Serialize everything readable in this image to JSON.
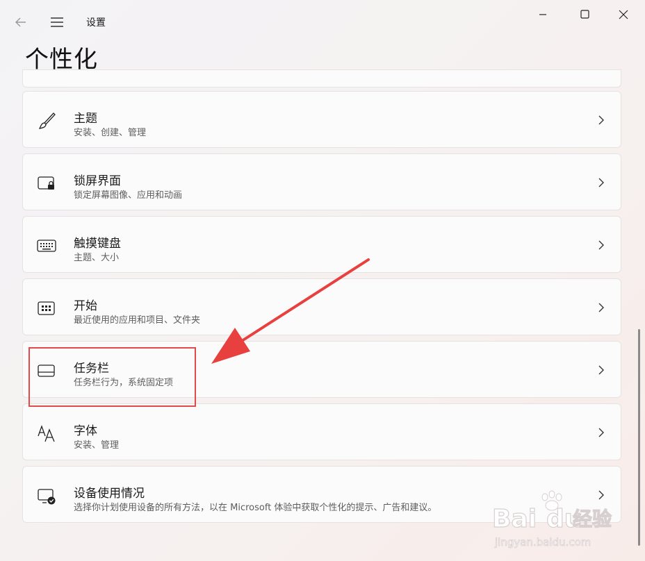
{
  "window": {
    "app_title": "设置",
    "page_title": "个性化"
  },
  "icons": {
    "back": "back-arrow-icon",
    "menu": "hamburger-menu-icon",
    "minimize": "minimize-icon",
    "maximize": "maximize-icon",
    "close": "close-icon"
  },
  "items": [
    {
      "title": "主题",
      "subtitle": "安装、创建、管理",
      "icon": "brush-icon"
    },
    {
      "title": "锁屏界面",
      "subtitle": "锁定屏幕图像、应用和动画",
      "icon": "lock-screen-icon"
    },
    {
      "title": "触摸键盘",
      "subtitle": "主题、大小",
      "icon": "keyboard-icon"
    },
    {
      "title": "开始",
      "subtitle": "最近使用的应用和项目、文件夹",
      "icon": "start-menu-icon"
    },
    {
      "title": "任务栏",
      "subtitle": "任务栏行为，系统固定项",
      "icon": "taskbar-icon"
    },
    {
      "title": "字体",
      "subtitle": "安装、管理",
      "icon": "font-icon"
    },
    {
      "title": "设备使用情况",
      "subtitle": "选择你计划使用设备的所有方法，以在 Microsoft 体验中获取个性化的提示、广告和建议。",
      "icon": "device-usage-icon"
    }
  ],
  "annotation": {
    "highlight_color": "#e24a4a"
  },
  "watermark": {
    "brand": "Bai",
    "brand_end": "du",
    "cn": "经验",
    "url": "jingyan.baidu.com"
  }
}
